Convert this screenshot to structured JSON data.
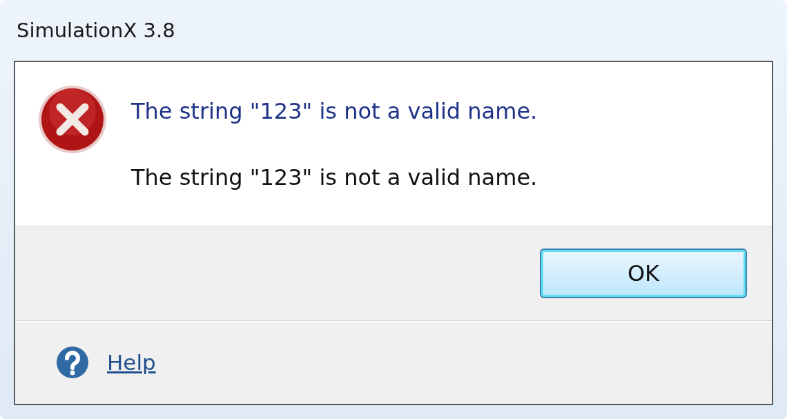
{
  "window": {
    "title": "SimulationX 3.8"
  },
  "message": {
    "instruction": "The string \"123\" is not a valid name.",
    "content": "The string \"123\" is not a valid name."
  },
  "buttons": [
    {
      "label": "OK",
      "default": true
    }
  ],
  "footer": {
    "link": "Help"
  }
}
